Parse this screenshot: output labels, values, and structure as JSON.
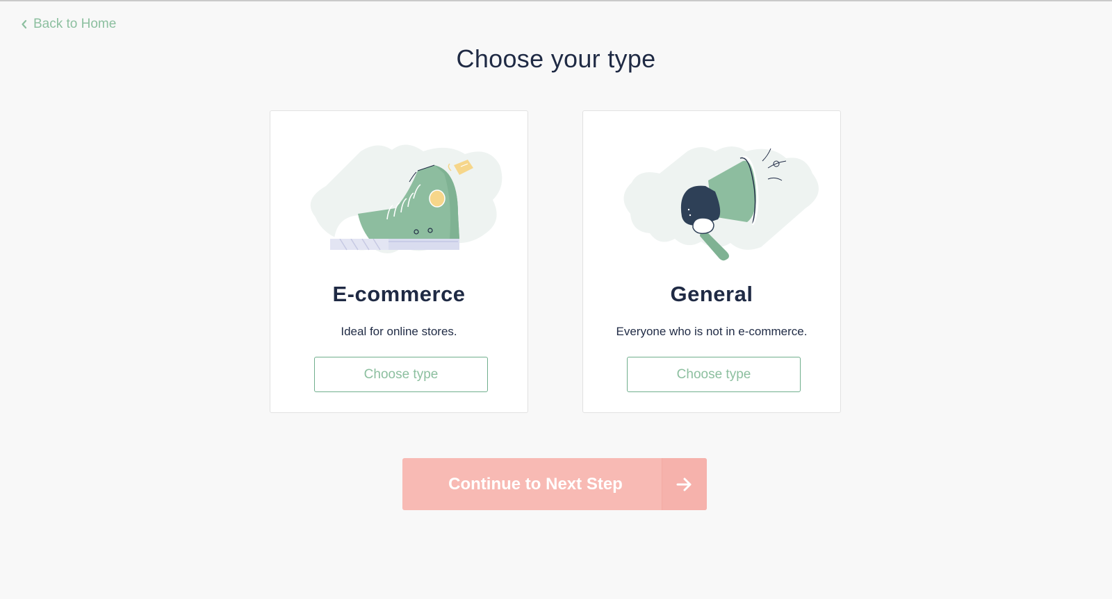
{
  "nav": {
    "back_label": "Back to Home",
    "back_icon": "chevron-left-icon"
  },
  "page": {
    "title": "Choose your type"
  },
  "cards": [
    {
      "title": "E-commerce",
      "description": "Ideal for online stores.",
      "button_label": "Choose type",
      "illustration": "sneaker-illustration"
    },
    {
      "title": "General",
      "description": "Everyone who is not in e-commerce.",
      "button_label": "Choose type",
      "illustration": "megaphone-illustration"
    }
  ],
  "footer": {
    "continue_label": "Continue to Next Step",
    "continue_icon": "arrow-right-icon"
  },
  "colors": {
    "accent_green": "#8cbf9f",
    "button_border_green": "#6fae8c",
    "continue_bg": "#f8bab4",
    "text_dark": "#1f2a44",
    "background": "#f8f8f8"
  }
}
